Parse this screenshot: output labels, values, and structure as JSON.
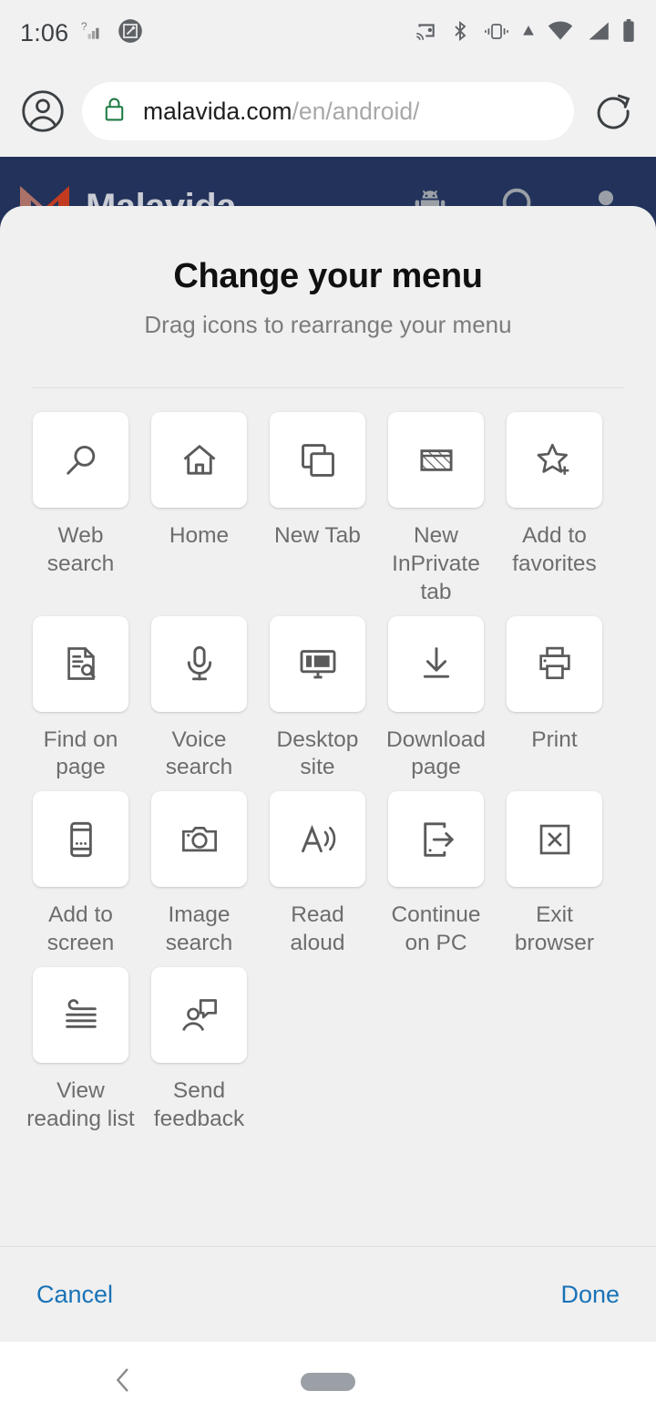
{
  "status_bar": {
    "time": "1:06",
    "left_icons": [
      "signal-unknown-icon",
      "screenshot-edit-icon"
    ],
    "right_icons": [
      "cast-icon",
      "bluetooth-icon",
      "vibrate-icon",
      "vpn-icon",
      "wifi-icon",
      "cell-signal-icon",
      "battery-icon"
    ]
  },
  "browser": {
    "profile_icon": "account-circle-icon",
    "lock_icon": "lock-icon",
    "url_host": "malavida.com",
    "url_path": "/en/android/",
    "url_full": "malavida.com/en/android/",
    "reload_icon": "reload-icon"
  },
  "site": {
    "name": "Malavida",
    "logo_icon": "malavida-m-logo",
    "header_color": "#22325a",
    "actions": [
      "android-robot-icon",
      "search-icon",
      "user-icon"
    ]
  },
  "sheet": {
    "title": "Change your menu",
    "subtitle": "Drag icons to rearrange your menu",
    "items": [
      {
        "label": "Web search",
        "icon": "search-icon"
      },
      {
        "label": "Home",
        "icon": "home-icon"
      },
      {
        "label": "New Tab",
        "icon": "new-tab-icon"
      },
      {
        "label": "New InPrivate tab",
        "icon": "inprivate-icon"
      },
      {
        "label": "Add to favorites",
        "icon": "star-plus-icon"
      },
      {
        "label": "Find on page",
        "icon": "find-on-page-icon"
      },
      {
        "label": "Voice search",
        "icon": "microphone-icon"
      },
      {
        "label": "Desktop site",
        "icon": "desktop-monitor-icon"
      },
      {
        "label": "Download page",
        "icon": "download-icon"
      },
      {
        "label": "Print",
        "icon": "printer-icon"
      },
      {
        "label": "Add to screen",
        "icon": "phone-icon"
      },
      {
        "label": "Image search",
        "icon": "camera-icon"
      },
      {
        "label": "Read aloud",
        "icon": "read-aloud-icon"
      },
      {
        "label": "Continue on PC",
        "icon": "continue-on-pc-icon"
      },
      {
        "label": "Exit browser",
        "icon": "exit-browser-icon"
      },
      {
        "label": "View reading list",
        "icon": "reading-list-icon"
      },
      {
        "label": "Send feedback",
        "icon": "send-feedback-icon"
      }
    ],
    "cancel_label": "Cancel",
    "done_label": "Done",
    "accent_color": "#1a73b7",
    "background_color": "#f0f0f0"
  },
  "nav_bar": {
    "back_icon": "back-chevron-icon",
    "home_pill": "home-pill-handle"
  }
}
